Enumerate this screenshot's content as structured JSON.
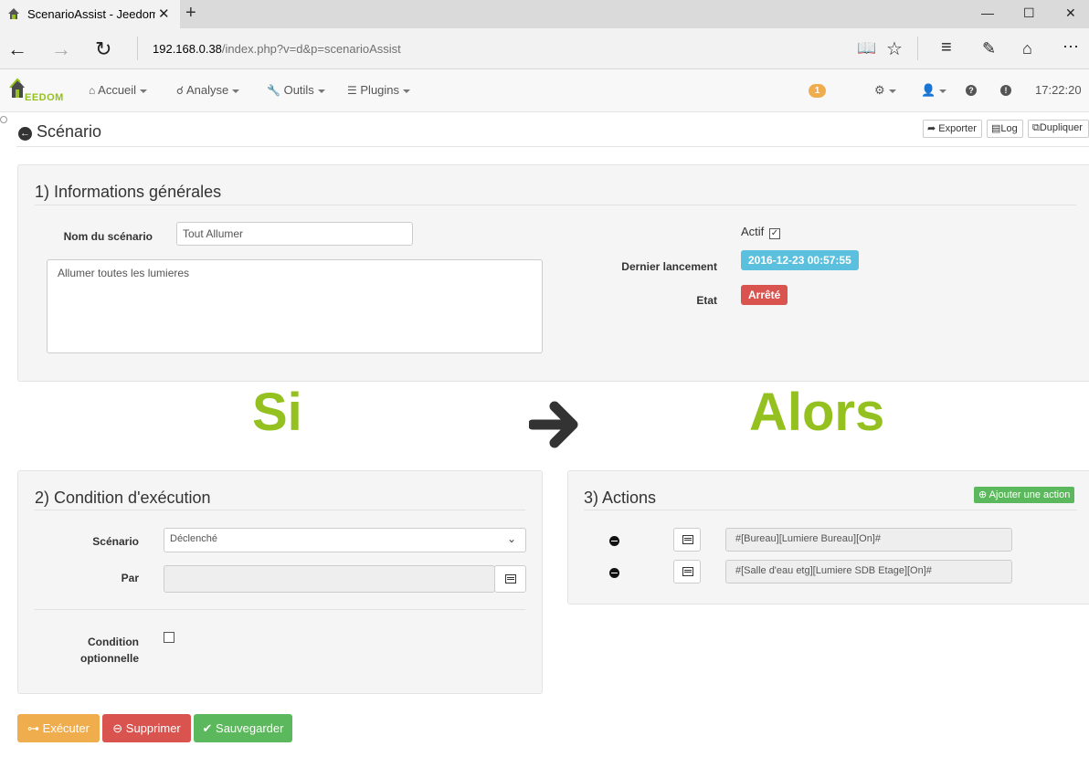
{
  "browser": {
    "tab_title": "ScenarioAssist - Jeedom",
    "url_host": "192.168.0.38",
    "url_path": "/index.php?v=d&p=scenarioAssist"
  },
  "navbar": {
    "logo": "EEDOM",
    "items": [
      {
        "label": "Accueil",
        "icon": "home-icon"
      },
      {
        "label": "Analyse",
        "icon": "analyse-icon"
      },
      {
        "label": "Outils",
        "icon": "wrench-icon"
      },
      {
        "label": "Plugins",
        "icon": "list-icon"
      }
    ],
    "notification_count": "1",
    "time": "17:22:20"
  },
  "page": {
    "title": "Scénario",
    "buttons": {
      "export": "Exporter",
      "log": "Log",
      "duplicate": "Dupliquer"
    }
  },
  "general": {
    "legend": "1) Informations générales",
    "name_label": "Nom du scénario",
    "name_value": "Tout Allumer",
    "description": "Allumer toutes les lumieres",
    "active_label": "Actif",
    "active_checked": true,
    "last_run_label": "Dernier lancement",
    "last_run_value": "2016-12-23 00:57:55",
    "state_label": "Etat",
    "state_value": "Arrêté"
  },
  "banner": {
    "si": "Si",
    "alors": "Alors"
  },
  "condition": {
    "legend": "2) Condition d'exécution",
    "scenario_label": "Scénario",
    "scenario_value": "Déclenché",
    "par_label": "Par",
    "par_value": "",
    "optional_label_1": "Condition",
    "optional_label_2": "optionnelle",
    "optional_checked": false
  },
  "actions": {
    "legend": "3) Actions",
    "add_label": "Ajouter une action",
    "items": [
      "#[Bureau][Lumiere Bureau][On]#",
      "#[Salle d'eau etg][Lumiere SDB Etage][On]#"
    ]
  },
  "footer_buttons": {
    "execute": "Exécuter",
    "delete": "Supprimer",
    "save": "Sauvegarder"
  },
  "colors": {
    "accent_green": "#94c11f",
    "info": "#5bc0de",
    "danger": "#d9534f",
    "warning": "#f0ad4e",
    "success": "#5cb85c"
  }
}
